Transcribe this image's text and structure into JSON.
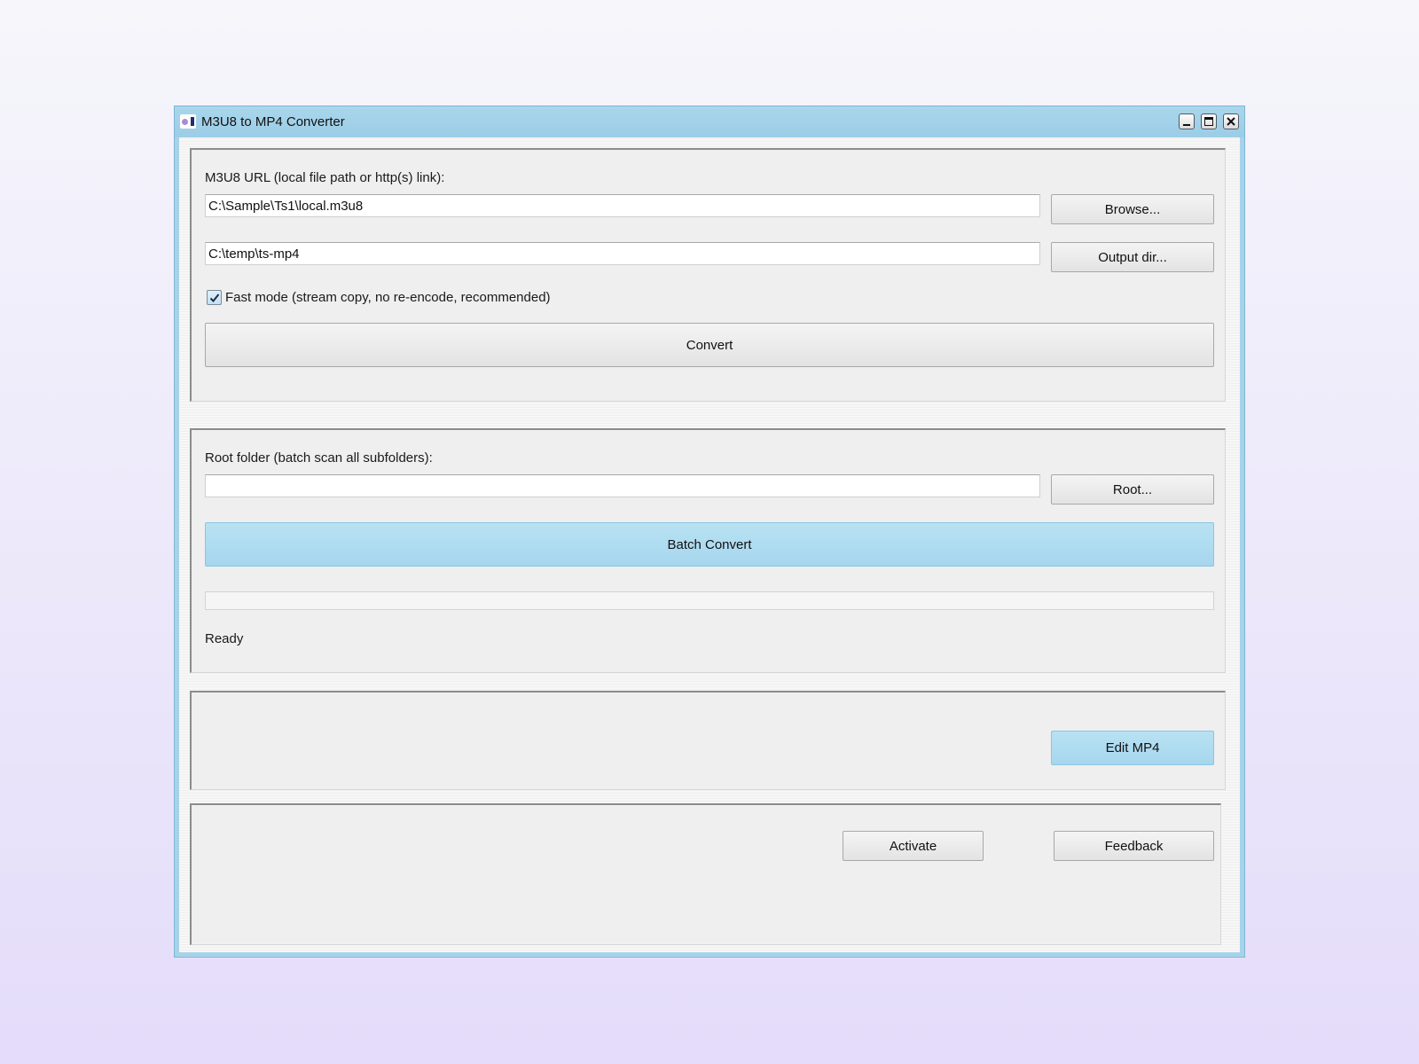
{
  "window": {
    "title": "M3U8 to MP4 Converter"
  },
  "single": {
    "url_label": "M3U8 URL (local file path or http(s) link):",
    "url_value": "C:\\Sample\\Ts1\\local.m3u8",
    "browse_label": "Browse...",
    "output_value": "C:\\temp\\ts-mp4",
    "output_dir_label": "Output dir...",
    "fast_mode_label": "Fast mode (stream copy, no re-encode, recommended)",
    "fast_mode_checked": true,
    "convert_label": "Convert"
  },
  "batch": {
    "root_label": "Root folder (batch scan all subfolders):",
    "root_value": "",
    "root_button_label": "Root...",
    "batch_convert_label": "Batch Convert",
    "progress_fraction": 0,
    "status": "Ready"
  },
  "edit": {
    "edit_mp4_label": "Edit MP4"
  },
  "footer": {
    "activate_label": "Activate",
    "feedback_label": "Feedback"
  },
  "colors": {
    "accent": "#a6d6ee",
    "titlebar": "#a9d6ec",
    "panel": "#efefef"
  },
  "icons": {
    "app": "converter-app-icon",
    "minimize": "minimize-icon",
    "maximize": "maximize-icon",
    "close": "close-icon",
    "check": "checkmark-icon"
  }
}
